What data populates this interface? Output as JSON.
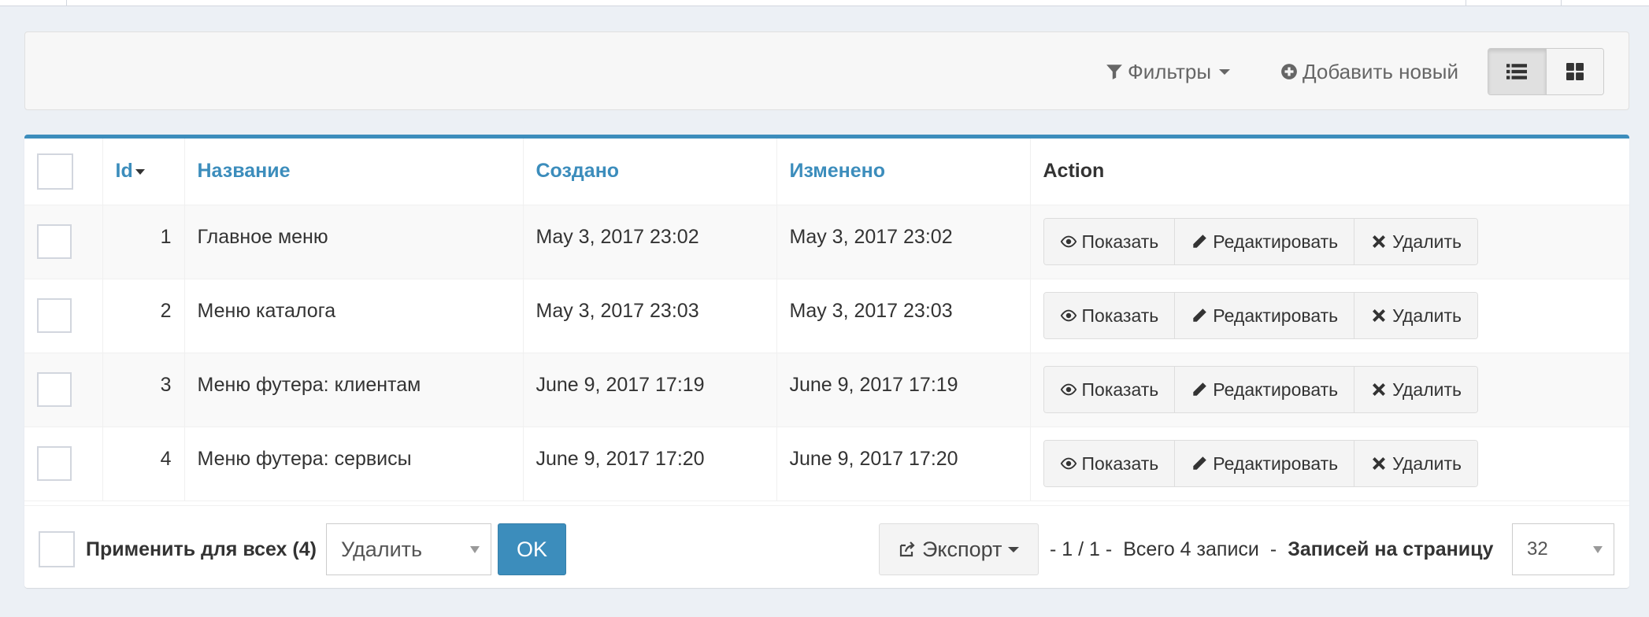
{
  "toolbar": {
    "filters_label": "Фильтры",
    "add_new_label": "Добавить новый",
    "list_view_icon": "list-icon",
    "grid_view_icon": "grid-icon"
  },
  "table": {
    "columns": {
      "id": "Id",
      "name": "Название",
      "created": "Создано",
      "updated": "Изменено",
      "action": "Action"
    },
    "rows": [
      {
        "id": "1",
        "name": "Главное меню",
        "created": "May 3, 2017 23:02",
        "updated": "May 3, 2017 23:02"
      },
      {
        "id": "2",
        "name": "Меню каталога",
        "created": "May 3, 2017 23:03",
        "updated": "May 3, 2017 23:03"
      },
      {
        "id": "3",
        "name": "Меню футера: клиентам",
        "created": "June 9, 2017 17:19",
        "updated": "June 9, 2017 17:19"
      },
      {
        "id": "4",
        "name": "Меню футера: сервисы",
        "created": "June 9, 2017 17:20",
        "updated": "June 9, 2017 17:20"
      }
    ],
    "row_actions": {
      "show": "Показать",
      "edit": "Редактировать",
      "delete": "Удалить"
    }
  },
  "footer": {
    "apply_all_label": "Применить для всех (4)",
    "batch_action_value": "Удалить",
    "ok_label": "OK",
    "export_label": "Экспорт",
    "pagination_text": "- 1 / 1 -",
    "total_text": "Всего 4 записи",
    "dash": "-",
    "per_page_label": "Записей на страницу",
    "per_page_value": "32"
  },
  "colors": {
    "accent": "#3c8dbc",
    "background": "#ecf0f5"
  }
}
